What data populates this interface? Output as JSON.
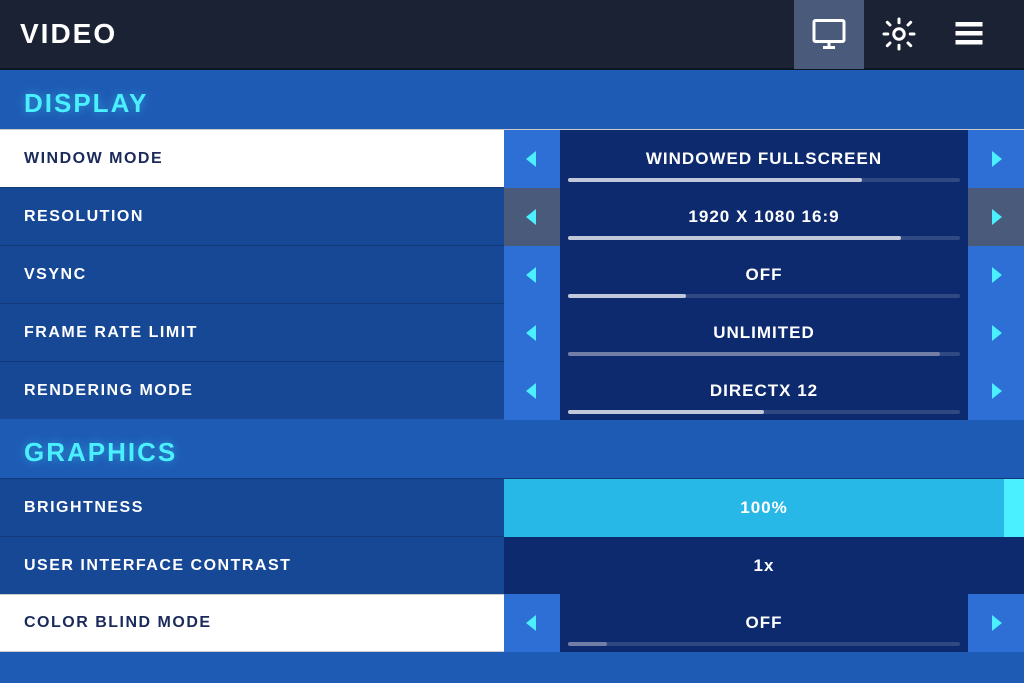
{
  "header": {
    "title": "VIDEO",
    "icons": [
      {
        "name": "monitor-icon",
        "active": true
      },
      {
        "name": "gear-icon",
        "active": false
      },
      {
        "name": "list-icon",
        "active": false
      }
    ]
  },
  "sections": [
    {
      "id": "display",
      "title": "DISPLAY",
      "rows": [
        {
          "id": "window-mode",
          "label": "WINDOW MODE",
          "value": "WINDOWED FULLSCREEN",
          "style": "white",
          "arrows": "blue",
          "barFill": 0.75,
          "barColor": "#4af0ff"
        },
        {
          "id": "resolution",
          "label": "RESOLUTION",
          "value": "1920 X 1080 16:9",
          "style": "dark",
          "arrows": "gray",
          "barFill": 0.85,
          "barColor": "#4af0ff"
        },
        {
          "id": "vsync",
          "label": "VSYNC",
          "value": "OFF",
          "style": "dark",
          "arrows": "blue",
          "barFill": 0.3,
          "barColor": "rgba(255,255,255,0.5)"
        },
        {
          "id": "frame-rate-limit",
          "label": "FRAME RATE LIMIT",
          "value": "UNLIMITED",
          "style": "dark",
          "arrows": "blue",
          "barFill": 0.95,
          "barColor": "rgba(200,200,220,0.5)"
        },
        {
          "id": "rendering-mode",
          "label": "RENDERING MODE",
          "value": "DIRECTX 12",
          "style": "dark",
          "arrows": "blue",
          "barFill": 0.5,
          "barColor": "rgba(255,255,255,0.5)"
        }
      ]
    },
    {
      "id": "graphics",
      "title": "GRAPHICS",
      "rows": [
        {
          "id": "brightness",
          "label": "BRIGHTNESS",
          "value": "100%",
          "type": "brightness"
        },
        {
          "id": "ui-contrast",
          "label": "USER INTERFACE CONTRAST",
          "value": "1x",
          "type": "contrast"
        },
        {
          "id": "color-blind-mode",
          "label": "COLOR BLIND MODE",
          "value": "OFF",
          "type": "selector",
          "style": "white",
          "arrows": "blue",
          "barFill": 0.1,
          "barColor": "rgba(100,100,200,0.5)"
        }
      ]
    }
  ]
}
